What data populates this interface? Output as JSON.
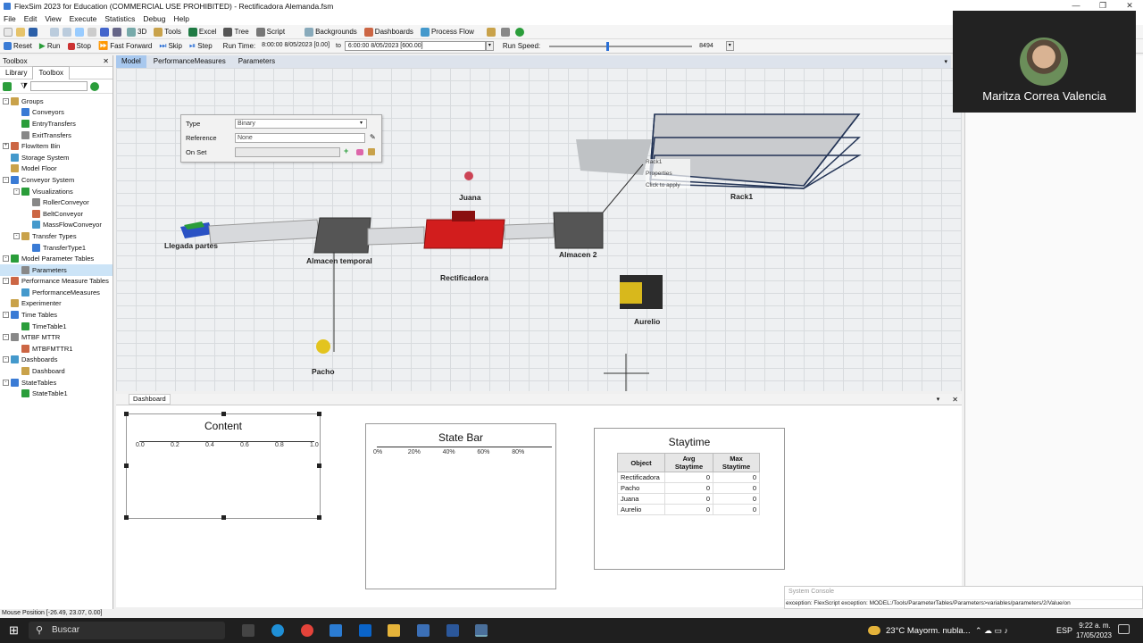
{
  "window": {
    "title": "FlexSim 2023 for Education (COMMERCIAL USE PROHIBITED) - Rectificadora Alemanda.fsm"
  },
  "menu": [
    "File",
    "Edit",
    "View",
    "Execute",
    "Statistics",
    "Debug",
    "Help"
  ],
  "toolbar": {
    "items": [
      "3D",
      "Tools",
      "Excel",
      "Tree",
      "Script",
      "Backgrounds",
      "Dashboards",
      "Process Flow"
    ]
  },
  "runbar": {
    "reset": "Reset",
    "run": "Run",
    "stop": "Stop",
    "fast_forward": "Fast Forward",
    "skip": "Skip",
    "step": "Step",
    "run_time_label": "Run Time:",
    "start_time": "8:00:00  8/05/2023 [0.00]",
    "to": "to",
    "end_time": "6:00:00  8/05/2023 [600.00]",
    "run_speed_label": "Run Speed:",
    "run_speed_value": "8494"
  },
  "toolbox": {
    "header": "Toolbox",
    "tabs": [
      "Library",
      "Toolbox"
    ],
    "tree": [
      {
        "label": "Groups",
        "level": 0,
        "exp": "-"
      },
      {
        "label": "Conveyors",
        "level": 1
      },
      {
        "label": "EntryTransfers",
        "level": 1
      },
      {
        "label": "ExitTransfers",
        "level": 1
      },
      {
        "label": "FlowItem Bin",
        "level": 0,
        "exp": "+"
      },
      {
        "label": "Storage System",
        "level": 0
      },
      {
        "label": "Model Floor",
        "level": 0
      },
      {
        "label": "Conveyor System",
        "level": 0,
        "exp": "-"
      },
      {
        "label": "Visualizations",
        "level": 1,
        "exp": "-"
      },
      {
        "label": "RollerConveyor",
        "level": 2
      },
      {
        "label": "BeltConveyor",
        "level": 2
      },
      {
        "label": "MassFlowConveyor",
        "level": 2
      },
      {
        "label": "Transfer Types",
        "level": 1,
        "exp": "-"
      },
      {
        "label": "TransferType1",
        "level": 2
      },
      {
        "label": "Model Parameter Tables",
        "level": 0,
        "exp": "-"
      },
      {
        "label": "Parameters",
        "level": 1,
        "selected": true
      },
      {
        "label": "Performance Measure Tables",
        "level": 0,
        "exp": "-"
      },
      {
        "label": "PerformanceMeasures",
        "level": 1
      },
      {
        "label": "Experimenter",
        "level": 0
      },
      {
        "label": "Time Tables",
        "level": 0,
        "exp": "-"
      },
      {
        "label": "TimeTable1",
        "level": 1
      },
      {
        "label": "MTBF MTTR",
        "level": 0,
        "exp": "-"
      },
      {
        "label": "MTBFMTTR1",
        "level": 1
      },
      {
        "label": "Dashboards",
        "level": 0,
        "exp": "-"
      },
      {
        "label": "Dashboard",
        "level": 1
      },
      {
        "label": "StateTables",
        "level": 0,
        "exp": "-"
      },
      {
        "label": "StateTable1",
        "level": 1
      }
    ]
  },
  "doc_tabs": [
    "Model",
    "PerformanceMeasures",
    "Parameters"
  ],
  "model": {
    "labels": {
      "llegada": "Llegada partes",
      "almacen_temporal": "Almacen temporal",
      "rectificadora": "Rectificadora",
      "almacen2": "Almacen 2",
      "juana": "Juana",
      "pacho": "Pacho",
      "aurelio": "Aurelio",
      "rack1": "Rack1"
    },
    "properties_panel": {
      "type_label": "Type",
      "type_value": "Binary",
      "reference_label": "Reference",
      "reference_value": "None",
      "onset_label": "On Set"
    },
    "tooltip": {
      "title": "Rack1",
      "properties": "Properties",
      "hint": "Click to apply"
    }
  },
  "video": {
    "name": "Maritza Correa Valencia"
  },
  "dashboard": {
    "tab": "Dashboard",
    "content": {
      "title": "Content",
      "ticks": [
        "0.0",
        "0.2",
        "0.4",
        "0.6",
        "0.8",
        "1.0"
      ]
    },
    "state_bar": {
      "title": "State Bar",
      "ticks": [
        "0%",
        "20%",
        "40%",
        "60%",
        "80%"
      ]
    },
    "staytime": {
      "title": "Staytime",
      "columns": [
        "Object",
        "Avg Staytime",
        "Max Staytime"
      ],
      "rows": [
        [
          "Rectificadora",
          "0",
          "0"
        ],
        [
          "Pacho",
          "0",
          "0"
        ],
        [
          "Juana",
          "0",
          "0"
        ],
        [
          "Aurelio",
          "0",
          "0"
        ]
      ]
    }
  },
  "console": {
    "title": "System Console",
    "message": "exception: FlexScript exception: MODEL:/Tools/ParameterTables/Parameters>variables/parameters/2/Value/on"
  },
  "status": {
    "mouse_position": "Mouse Position [-26.49, 23.07, 0.00]"
  },
  "taskbar": {
    "search": "Buscar",
    "weather": "23°C  Mayorm. nubla...",
    "lang": "ESP",
    "time": "9:22 a. m.",
    "date": "17/05/2023"
  }
}
